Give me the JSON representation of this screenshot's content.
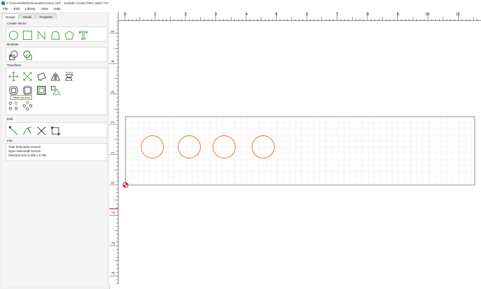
{
  "window": {
    "title": "C:\\Users\\wills\\Downloads\\contour.c2d* - Carbide Create PRO, Build 717"
  },
  "menu": [
    "File",
    "Edit",
    "Library",
    "View",
    "Help"
  ],
  "tabs": [
    "Design",
    "Model",
    "Toolpaths"
  ],
  "sections": {
    "create_vector": "Create Vector",
    "boolean": "Boolean",
    "transform": "Transform",
    "edit": "Edit",
    "info": "Info"
  },
  "tooltip": "Offset Vectors",
  "info": {
    "total_selected_label": "Total Selected:",
    "total_selected_value": "4 Vectors",
    "open_selected_label": "Open Selected:",
    "open_selected_value": "0 Vectors",
    "selected_size_label": "Selected Size:",
    "selected_size_value": "4.396 x 0.750"
  },
  "ruler": {
    "x_labels": [
      "0",
      "1",
      "2",
      "3",
      "4",
      "5",
      "6",
      "7",
      "8",
      "9",
      "10",
      "11"
    ],
    "y_labels": [
      "5",
      "4",
      "3",
      "2",
      "1",
      "0",
      "-1",
      "-2",
      "-3"
    ]
  },
  "colors": {
    "vector": "#f07020",
    "tool_icon": "#3aa03a",
    "origin": "#e02020"
  }
}
